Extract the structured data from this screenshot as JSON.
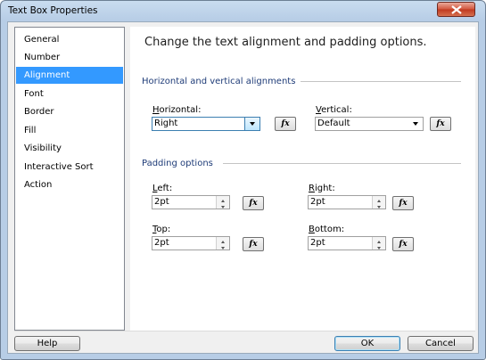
{
  "window": {
    "title": "Text Box Properties"
  },
  "sidebar": {
    "items": [
      {
        "label": "General"
      },
      {
        "label": "Number"
      },
      {
        "label": "Alignment"
      },
      {
        "label": "Font"
      },
      {
        "label": "Border"
      },
      {
        "label": "Fill"
      },
      {
        "label": "Visibility"
      },
      {
        "label": "Interactive Sort"
      },
      {
        "label": "Action"
      }
    ],
    "selected": "Alignment"
  },
  "main": {
    "heading": "Change the text alignment and padding options.",
    "alignment_group": {
      "title": "Horizontal and vertical alignments",
      "horizontal": {
        "label_key": "H",
        "label_rest": "orizontal:",
        "value": "Right"
      },
      "vertical": {
        "label_key": "V",
        "label_rest": "ertical:",
        "value": "Default"
      }
    },
    "padding_group": {
      "title": "Padding options",
      "left": {
        "label_key": "L",
        "label_rest": "eft:",
        "value": "2pt"
      },
      "right": {
        "label_key": "R",
        "label_rest": "ight:",
        "value": "2pt"
      },
      "top": {
        "label_key": "T",
        "label_rest": "op:",
        "value": "2pt"
      },
      "bottom": {
        "label_key": "B",
        "label_rest": "ottom:",
        "value": "2pt"
      }
    },
    "fx_label": "fx"
  },
  "footer": {
    "help_label": "Help",
    "ok_label": "OK",
    "cancel_label": "Cancel"
  },
  "colors": {
    "selection": "#3399ff",
    "group_title": "#1f3c78",
    "close_button": "#c0391f"
  }
}
